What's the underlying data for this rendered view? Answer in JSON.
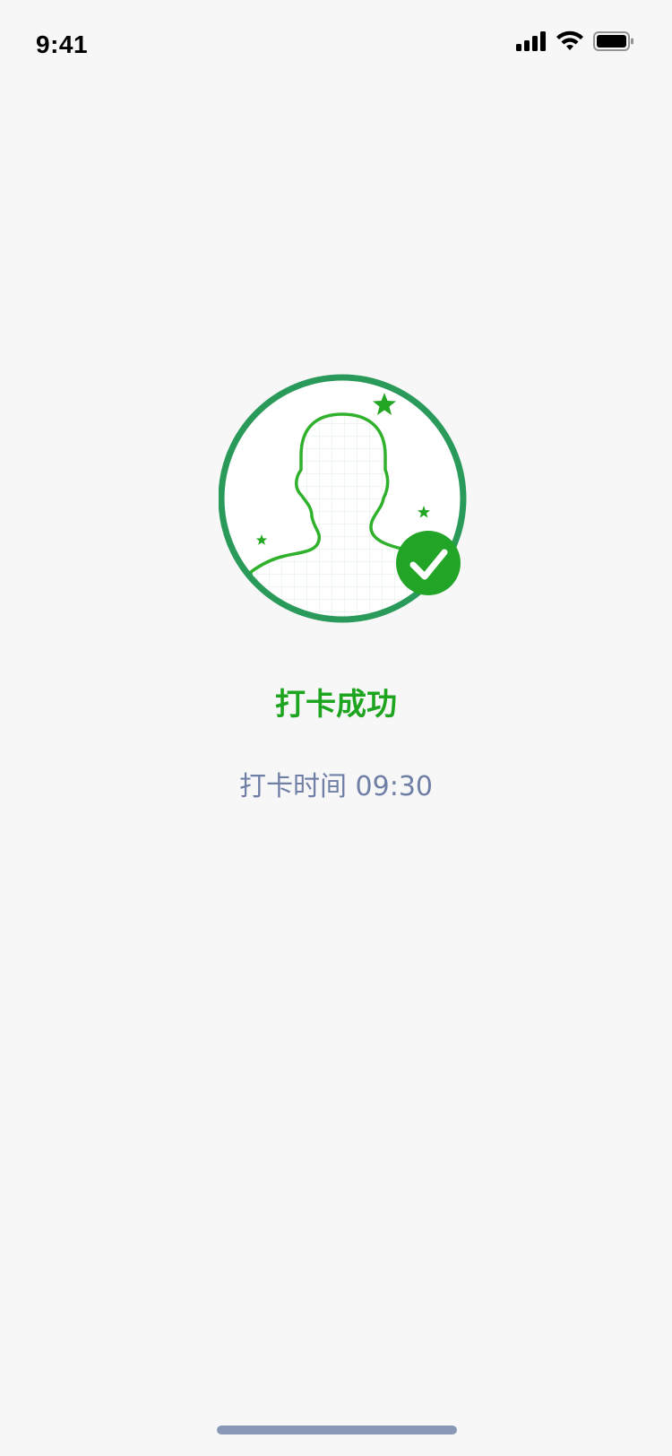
{
  "status_bar": {
    "time": "9:41",
    "icons": [
      "cellular-signal-icon",
      "wifi-icon",
      "battery-icon"
    ]
  },
  "result": {
    "illustration": "face-recognition-success-icon",
    "title": "打卡成功",
    "time_text": "打卡时间 09:30"
  },
  "colors": {
    "accent_green": "#1ea51f",
    "ring_green": "#2a9a5a",
    "secondary_text": "#6f7fa6",
    "background": "#f7f7f8",
    "home_indicator": "#8a98b8"
  }
}
